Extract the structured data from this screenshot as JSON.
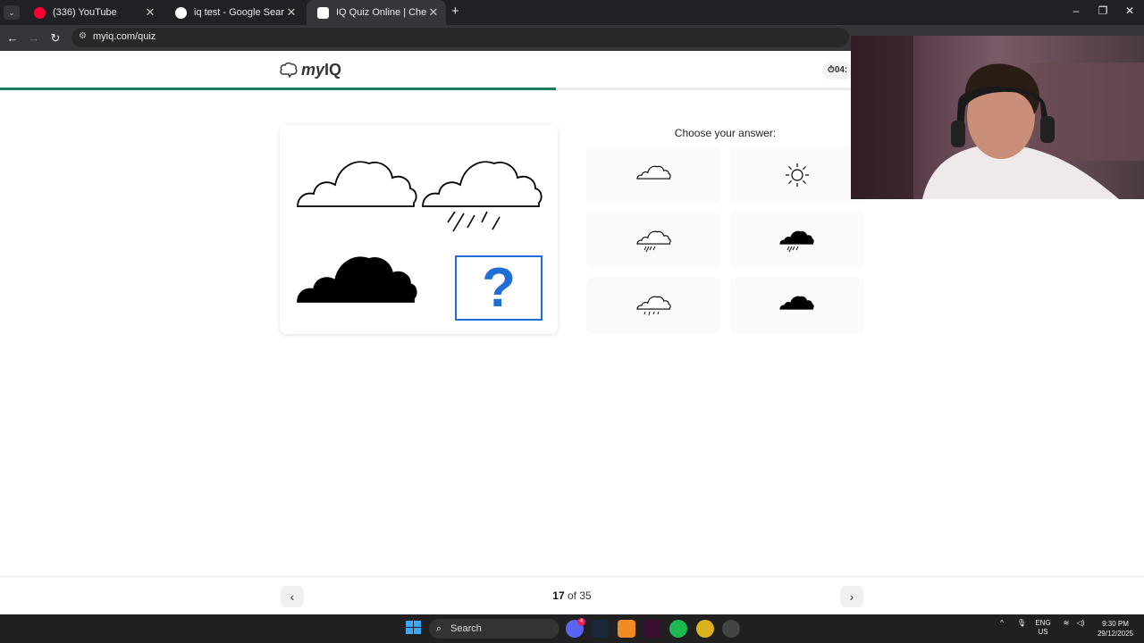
{
  "browser": {
    "tabs": [
      {
        "title": "(336) YouTube",
        "close": "✕",
        "favicon_color": "#ff0033"
      },
      {
        "title": "iq test - Google Search",
        "close": "✕",
        "favicon_color": "#ffffff"
      },
      {
        "title": "IQ Quiz Online | Check Your IQ",
        "close": "✕",
        "favicon_color": "#ffffff",
        "active": true
      }
    ],
    "new_tab": "+",
    "url": "myiq.com/quiz"
  },
  "site": {
    "logo_my": "my",
    "logo_iq": "IQ",
    "timer": "04:",
    "progress_fraction": 0.4857,
    "accent": "#1a7a5e"
  },
  "quiz": {
    "prompt": "Choose your answer:",
    "question_mark": "?",
    "question_color": "#1f6fd6",
    "cells": [
      {
        "name": "outline-cloud-icon"
      },
      {
        "name": "outline-rain-cloud-icon"
      },
      {
        "name": "black-cloud-icon"
      },
      {
        "name": "question-box"
      }
    ],
    "options": [
      {
        "name": "option-outline-cloud",
        "icon": "outline-cloud-icon"
      },
      {
        "name": "option-sun",
        "icon": "sun-icon"
      },
      {
        "name": "option-outline-cloud-rain",
        "icon": "outline-rain-cloud-icon"
      },
      {
        "name": "option-black-cloud-rain",
        "icon": "black-rain-cloud-icon"
      },
      {
        "name": "option-outline-cloud-drizzle",
        "icon": "outline-drizzle-cloud-icon"
      },
      {
        "name": "option-black-cloud",
        "icon": "black-cloud-icon"
      }
    ]
  },
  "pagination": {
    "current": "17",
    "of_text": " of 35",
    "prev": "‹",
    "next": "›"
  },
  "taskbar": {
    "search_label": "Search",
    "lang": "ENG",
    "region": "US",
    "time": "9:30 PM",
    "date": "29/12/2025",
    "discord_badge": "4"
  }
}
